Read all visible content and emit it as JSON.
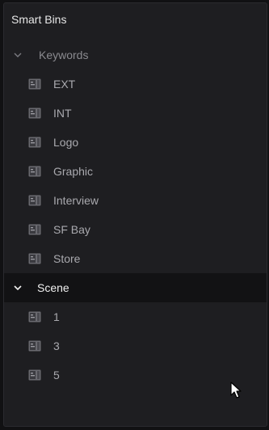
{
  "panel": {
    "title": "Smart Bins"
  },
  "groups": [
    {
      "label": "Keywords",
      "icon": "chevron-down-icon",
      "items": [
        "EXT",
        "INT",
        "Logo",
        "Graphic",
        "Interview",
        "SF Bay",
        "Store"
      ]
    },
    {
      "label": "Scene",
      "icon": "chevron-down-icon",
      "items": [
        "1",
        "3",
        "5"
      ]
    }
  ],
  "item_icon": "smart-bin-icon",
  "cursor_icon": "mouse-pointer-icon",
  "colors": {
    "panel_bg": "#1e1e21",
    "selected_group_bg": "#121214",
    "dim_text": "#a9a9ae",
    "bright_text": "#f0f0f0"
  }
}
